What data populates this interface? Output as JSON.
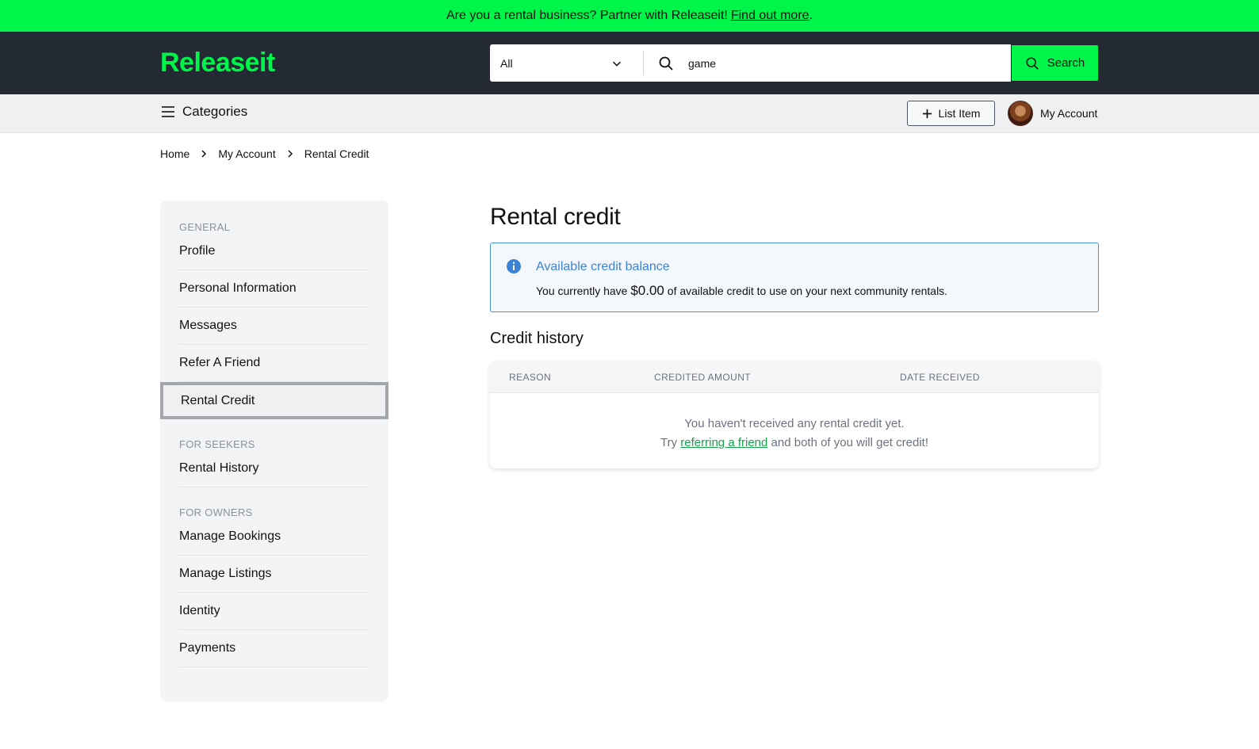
{
  "promo": {
    "text": "Are you a rental business? Partner with Releaseit!",
    "link": "Find out more",
    "suffix": "."
  },
  "header": {
    "logo": "Releaseit",
    "category_select": "All",
    "search_value": "game",
    "search_button": "Search"
  },
  "subnav": {
    "categories": "Categories",
    "list_item": "List Item",
    "account": "My Account"
  },
  "breadcrumb": [
    "Home",
    "My Account",
    "Rental Credit"
  ],
  "sidebar": {
    "general_heading": "GENERAL",
    "general_items": [
      "Profile",
      "Personal Information",
      "Messages",
      "Refer A Friend",
      "Rental Credit"
    ],
    "seekers_heading": "FOR SEEKERS",
    "seekers_items": [
      "Rental History"
    ],
    "owners_heading": "FOR OWNERS",
    "owners_items": [
      "Manage Bookings",
      "Manage Listings",
      "Identity",
      "Payments"
    ]
  },
  "main": {
    "title": "Rental credit",
    "alert": {
      "title": "Available credit balance",
      "text_before": "You currently have",
      "amount": "$0.00",
      "text_after": "of available credit to use on your next community rentals."
    },
    "history_title": "Credit history",
    "table": {
      "columns": [
        "REASON",
        "CREDITED AMOUNT",
        "DATE RECEIVED"
      ],
      "empty_line1": "You haven't received any rental credit yet.",
      "empty_try": "Try",
      "empty_link": "referring a friend",
      "empty_after": "and both of you will get credit!"
    }
  },
  "colors": {
    "brand_green": "#00f54a",
    "header_bg": "#232a33",
    "info_blue": "#3b82d9",
    "link_green": "#16a34a"
  }
}
